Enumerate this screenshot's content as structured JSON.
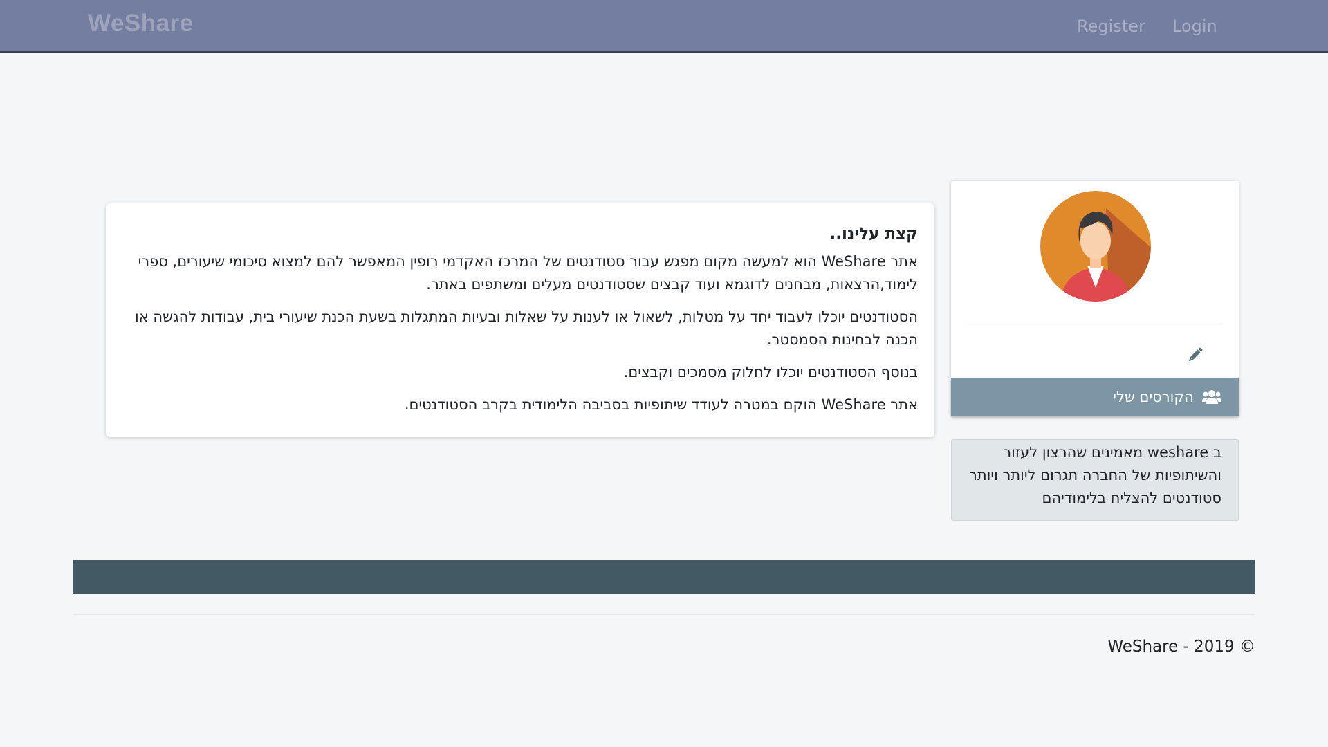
{
  "navbar": {
    "brand": "WeShare",
    "links": [
      {
        "label": "Register"
      },
      {
        "label": "Login"
      }
    ]
  },
  "about": {
    "title": "קצת עלינו..",
    "paragraphs": [
      "אתר WeShare הוא למעשה מקום מפגש עבור סטודנטים של המרכז האקדמי רופין המאפשר להם למצוא סיכומי שיעורים, ספרי לימוד,הרצאות, מבחנים לדוגמא ועוד קבצים שסטודנטים מעלים ומשתפים באתר.",
      "הסטודנטים יוכלו לעבוד יחד על מטלות, לשאול או לענות על שאלות ובעיות המתגלות בשעת הכנת שיעורי בית, עבודות להגשה או הכנה לבחינות הסמסטר.",
      "בנוסף הסטודנטים יוכלו לחלוק מסמכים וקבצים.",
      "אתר WeShare הוקם במטרה לעודד שיתופיות בסביבה הלימודית בקרב הסטודנטים."
    ]
  },
  "profile": {
    "avatar_icon": "user-avatar-icon",
    "edit_icon": "pencil-icon",
    "courses_label": "הקורסים שלי",
    "courses_icon": "users-icon"
  },
  "info_box": {
    "text": "ב weshare מאמינים שהרצון לעזור והשיתופיות של החברה תגרום ליותר ויותר סטודנטים להצליח בלימודיהם"
  },
  "footer": {
    "copyright": "WeShare - 2019 ©"
  },
  "colors": {
    "navbar": "#747ea1",
    "footer_bar": "#435a64",
    "courses_bar": "#7c96a6",
    "info_box": "#e1e6e9",
    "page_bg": "#f4f6f8"
  }
}
